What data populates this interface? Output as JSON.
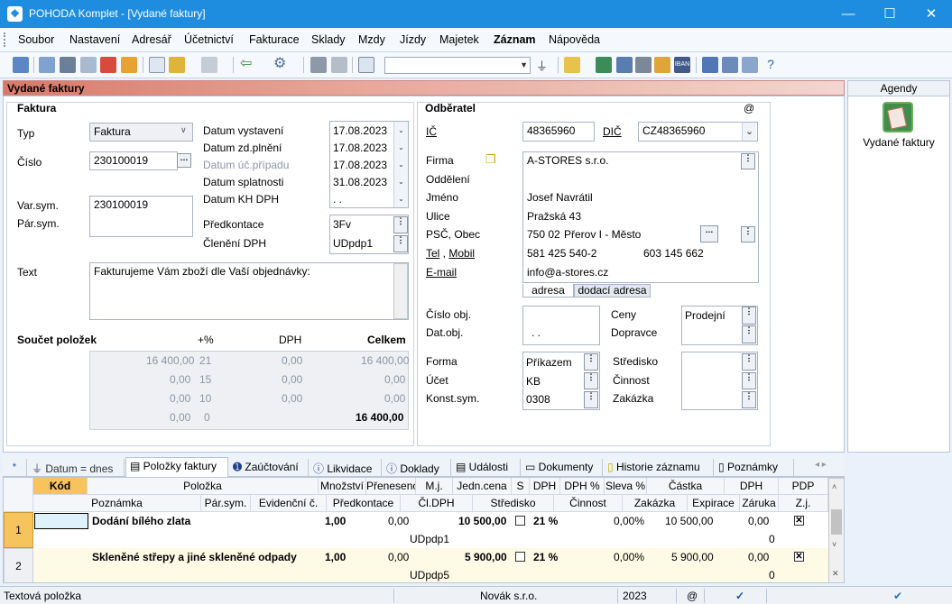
{
  "window": {
    "title": "POHODA Komplet - [Vydané faktury]",
    "min": "—",
    "max": "☐",
    "close": "✕"
  },
  "menu": [
    "Soubor",
    "Nastavení",
    "Adresář",
    "Účetnictví",
    "Fakturace",
    "Sklady",
    "Mzdy",
    "Jízdy",
    "Majetek",
    "Záznam",
    "Nápověda"
  ],
  "panel_title": "Vydané faktury",
  "faktura": {
    "section": "Faktura",
    "typ_label": "Typ",
    "typ_value": "Faktura",
    "cislo_label": "Číslo",
    "cislo_value": "230100019",
    "varsym_label": "Var.sym.",
    "parsym_label": "Pár.sym.",
    "varsym_value": "230100019",
    "text_label": "Text",
    "text_value": "Fakturujeme Vám zboží dle Vaší objednávky:",
    "dates": [
      {
        "label": "Datum vystavení",
        "value": "17.08.2023"
      },
      {
        "label": "Datum zd.plnění",
        "value": "17.08.2023"
      },
      {
        "label": "Datum úč.případu",
        "value": "17.08.2023"
      },
      {
        "label": "Datum splatnosti",
        "value": "31.08.2023"
      },
      {
        "label": "Datum KH DPH",
        "value": " .  ."
      }
    ],
    "predkontace_label": "Předkontace",
    "predkontace_value": "3Fv",
    "cleneni_label": "Členění DPH",
    "cleneni_value": "UDpdp1"
  },
  "soucet": {
    "label": "Součet položek",
    "h_pct": "+%",
    "h_dph": "DPH",
    "h_celkem": "Celkem",
    "rows": [
      {
        "base": "16 400,00",
        "pct": "21",
        "dph": "0,00",
        "total": "16 400,00"
      },
      {
        "base": "0,00",
        "pct": "15",
        "dph": "0,00",
        "total": "0,00"
      },
      {
        "base": "0,00",
        "pct": "10",
        "dph": "0,00",
        "total": "0,00"
      },
      {
        "base": "0,00",
        "pct": "0",
        "dph": "",
        "total": "16 400,00"
      }
    ]
  },
  "odberatel": {
    "section": "Odběratel",
    "at": "@",
    "ic_label": "IČ",
    "ic_value": "48365960",
    "dic_label": "DIČ",
    "dic_value": "CZ48365960",
    "firma_label": "Firma",
    "firma_value": "A-STORES s.r.o.",
    "oddeleni_label": "Oddělení",
    "jmeno_label": "Jméno",
    "jmeno_value": "Josef Navrátil",
    "ulice_label": "Ulice",
    "ulice_value": "Pražská 43",
    "psc_label": "PSČ, Obec",
    "psc_value": "750 02",
    "obec_value": "Přerov I - Město",
    "tel_label": "Tel",
    "mobil_label": "Mobil",
    "tel_value": "581 425 540-2",
    "mobil_value": "603 145 662",
    "email_label": "E-mail",
    "email_value": "info@a-stores.cz",
    "tab_adresa": "adresa",
    "tab_dodaci": "dodací adresa",
    "cisloobj_label": "Číslo obj.",
    "datobj_label": "Dat.obj.",
    "datobj_value": " .  .",
    "ceny_label": "Ceny",
    "ceny_value": "Prodejní",
    "dopravce_label": "Dopravce",
    "forma_label": "Forma",
    "forma_value": "Příkazem",
    "ucet_label": "Účet",
    "ucet_value": "KB",
    "konst_label": "Konst.sym.",
    "konst_value": "0308",
    "stredisko_label": "Středisko",
    "cinnost_label": "Činnost",
    "zakazka_label": "Zakázka"
  },
  "agendy": {
    "header": "Agendy",
    "item": "Vydané faktury"
  },
  "tabs": [
    "*",
    "Datum = dnes",
    "Položky faktury",
    "Zaúčtování",
    "Likvidace",
    "Doklady",
    "Události",
    "Dokumenty",
    "Historie záznamu",
    "Poznámky"
  ],
  "grid": {
    "h1": [
      "Kód",
      "Položka",
      "Množství",
      "Přeneseno",
      "M.j.",
      "Jedn.cena",
      "S",
      "DPH",
      "DPH %",
      "Sleva %",
      "Částka",
      "DPH",
      "PDP"
    ],
    "h2": [
      "Poznámka",
      "Pár.sym.",
      "Evidenční č.",
      "Předkontace",
      "Čl.DPH",
      "Středisko",
      "Činnost",
      "Zakázka",
      "Expirace",
      "Záruka",
      "Z.j."
    ],
    "rows": [
      {
        "num": "1",
        "name": "Dodání bílého zlata",
        "qty": "1,00",
        "pren": "0,00",
        "price": "10 500,00",
        "dph": "21 %",
        "sleva": "0,00%",
        "castka": "10 500,00",
        "dphv": "0,00",
        "cldph": "UDpdp1",
        "zaruka": "0"
      },
      {
        "num": "2",
        "name": "Skleněné střepy a jiné skleněné odpady",
        "qty": "1,00",
        "pren": "0,00",
        "price": "5 900,00",
        "dph": "21 %",
        "sleva": "0,00%",
        "castka": "5 900,00",
        "dphv": "0,00",
        "cldph": "UDpdp5",
        "zaruka": "0"
      }
    ]
  },
  "status": {
    "left": "Textová položka",
    "company": "Novák s.r.o.",
    "year": "2023",
    "at": "@"
  }
}
